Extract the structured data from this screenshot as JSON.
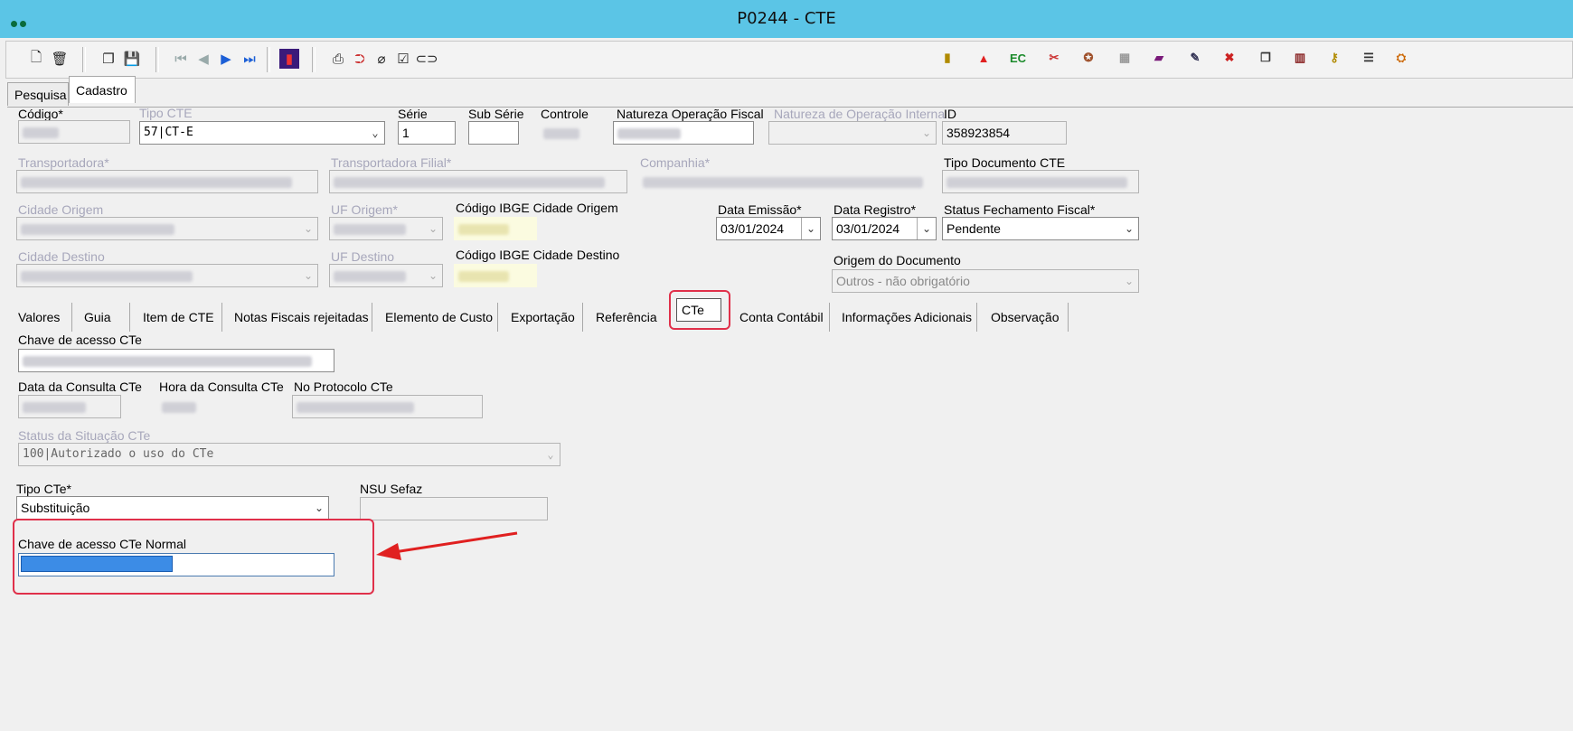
{
  "window": {
    "title": "P0244 - CTE"
  },
  "tabs": [
    {
      "label": "Pesquisa"
    },
    {
      "label": "Cadastro"
    }
  ],
  "header": {
    "codigo_label": "Código*",
    "tipo_cte_label": "Tipo CTE",
    "tipo_cte_value": "57|CT-E",
    "serie_label": "Série",
    "serie_value": "1",
    "sub_serie_label": "Sub Série",
    "controle_label": "Controle",
    "natureza_op_fiscal_label": "Natureza Operação Fiscal",
    "natureza_op_interna_label": "Natureza de Operação Interna",
    "id_label": "ID",
    "id_value": "358923854",
    "transportadora_label": "Transportadora*",
    "transportadora_filial_label": "Transportadora Filial*",
    "companhia_label": "Companhia*",
    "tipo_doc_label": "Tipo Documento CTE",
    "cidade_origem_label": "Cidade Origem",
    "uf_origem_label": "UF Origem*",
    "ibge_origem_label": "Código IBGE Cidade Origem",
    "data_emissao_label": "Data Emissão*",
    "data_emissao_value": "03/01/2024",
    "data_registro_label": "Data Registro*",
    "data_registro_value": "03/01/2024",
    "status_fechamento_label": "Status Fechamento Fiscal*",
    "status_fechamento_value": "Pendente",
    "cidade_destino_label": "Cidade Destino",
    "uf_destino_label": "UF Destino",
    "ibge_destino_label": "Código IBGE Cidade Destino",
    "origem_doc_label": "Origem do Documento",
    "origem_doc_value": "Outros - não obrigatório"
  },
  "subtabs": [
    {
      "label": "Valores"
    },
    {
      "label": "Guia"
    },
    {
      "label": "Item de CTE"
    },
    {
      "label": "Notas Fiscais rejeitadas"
    },
    {
      "label": "Elemento de Custo"
    },
    {
      "label": "Exportação"
    },
    {
      "label": "Referência"
    },
    {
      "label": "CTe"
    },
    {
      "label": "Conta Contábil"
    },
    {
      "label": "Informações Adicionais"
    },
    {
      "label": "Observação"
    }
  ],
  "cte": {
    "chave_acesso_label": "Chave de acesso CTe",
    "data_consulta_label": "Data da Consulta CTe",
    "hora_consulta_label": "Hora da Consulta CTe",
    "protocolo_label": "No Protocolo CTe",
    "status_situacao_label": "Status da Situação CTe",
    "status_situacao_value": "100|Autorizado o uso do CTe",
    "tipo_cte_label": "Tipo CTe*",
    "tipo_cte_value": "Substituição",
    "nsu_label": "NSU Sefaz",
    "chave_normal_label": "Chave de acesso CTe Normal"
  },
  "icons": {
    "new": "new-document-icon",
    "delete": "trash-icon",
    "copy": "copy-icon",
    "save": "save-icon",
    "first": "first-record-icon",
    "prev": "previous-record-icon",
    "next": "next-record-icon",
    "last": "last-record-icon",
    "chart": "chart-icon",
    "print": "print-icon",
    "attach": "attach-icon",
    "link": "link-icon"
  },
  "colors": {
    "titlebar": "#5bc5e6",
    "highlight": "#e0304a",
    "selection": "#3c8ce6"
  }
}
